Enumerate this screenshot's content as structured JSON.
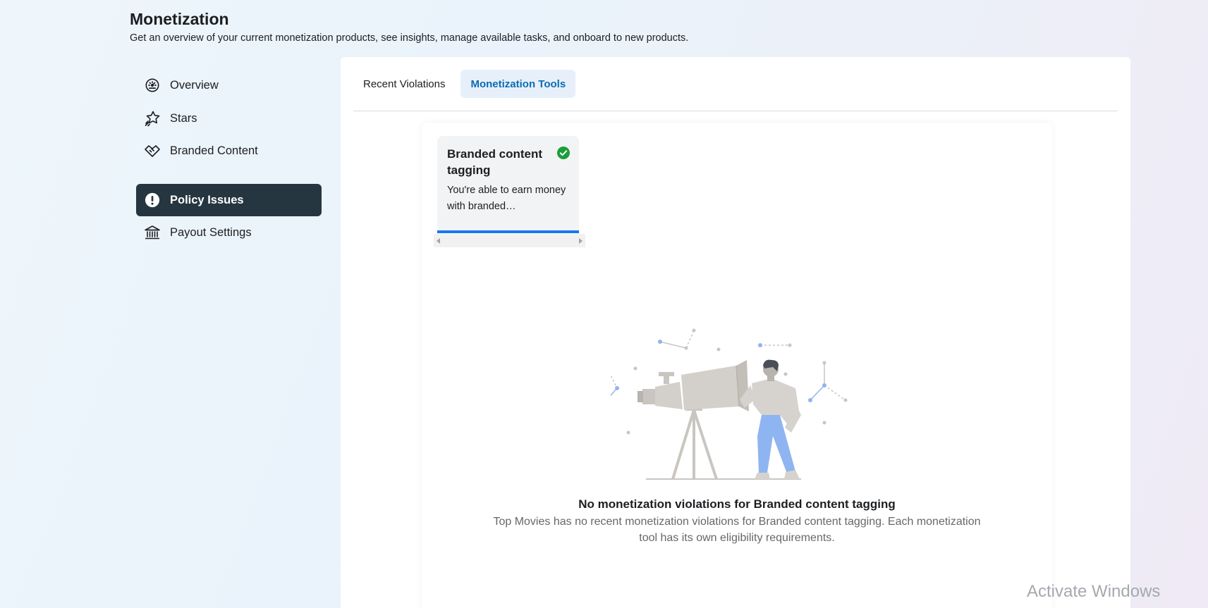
{
  "header": {
    "title": "Monetization",
    "subtitle": "Get an overview of your current monetization products, see insights, manage available tasks, and onboard to new products."
  },
  "sidebar": {
    "items": [
      {
        "label": "Overview",
        "icon": "gauge-icon",
        "active": false
      },
      {
        "label": "Stars",
        "icon": "star-icon",
        "active": false
      },
      {
        "label": "Branded Content",
        "icon": "handshake-icon",
        "active": false
      },
      {
        "label": "Policy Issues",
        "icon": "exclamation-circle-icon",
        "active": true
      },
      {
        "label": "Payout Settings",
        "icon": "bank-icon",
        "active": false
      }
    ]
  },
  "tabs": [
    {
      "label": "Recent Violations",
      "active": false
    },
    {
      "label": "Monetization Tools",
      "active": true
    }
  ],
  "tool_card": {
    "title": "Branded content tagging",
    "description": "You're able to earn money with branded…",
    "status_icon": "check-circle-icon",
    "status_color": "#1b9e3a"
  },
  "empty_state": {
    "title": "No monetization violations for Branded content tagging",
    "description": "Top Movies has no recent monetization violations for Branded content tagging. Each monetization tool has its own eligibility requirements."
  },
  "watermark": "Activate Windows",
  "colors": {
    "accent": "#1877f2",
    "active_tab_text": "#0a6cb5",
    "sidebar_active_bg": "#263640"
  }
}
